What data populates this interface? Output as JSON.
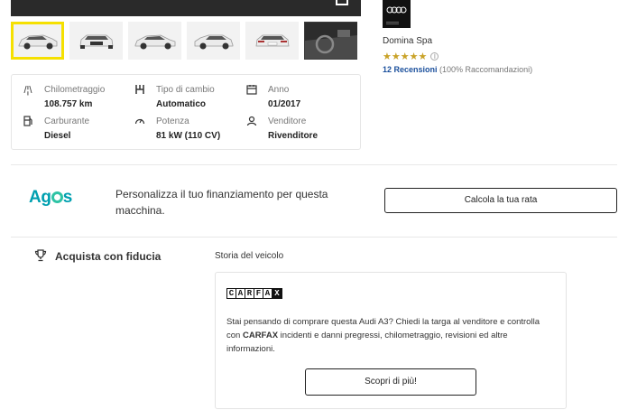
{
  "gallery": {
    "thumbnails": [
      {
        "label": "front-3q-view",
        "active": true
      },
      {
        "label": "front-view",
        "active": false
      },
      {
        "label": "side-view",
        "active": false
      },
      {
        "label": "rear-3q-view",
        "active": false
      },
      {
        "label": "rear-view",
        "active": false
      },
      {
        "label": "interior-view",
        "active": false
      }
    ]
  },
  "specs": {
    "mileage": {
      "label": "Chilometraggio",
      "value": "108.757 km",
      "icon": "road-icon"
    },
    "gearbox": {
      "label": "Tipo di cambio",
      "value": "Automatico",
      "icon": "gearshift-icon"
    },
    "year": {
      "label": "Anno",
      "value": "01/2017",
      "icon": "calendar-icon"
    },
    "fuel": {
      "label": "Carburante",
      "value": "Diesel",
      "icon": "fuel-icon"
    },
    "power": {
      "label": "Potenza",
      "value": "81 kW (110 CV)",
      "icon": "speedometer-icon"
    },
    "seller": {
      "label": "Venditore",
      "value": "Rivenditore",
      "icon": "person-icon"
    }
  },
  "dealer": {
    "name": "Domina Spa",
    "rating_stars": "★★★★★",
    "reviews_link": "12 Recensioni",
    "reviews_suffix": " (100% Raccomandazioni)"
  },
  "finance": {
    "brand": "Agos",
    "brand_left": "Ag",
    "brand_right": "s",
    "text": "Personalizza il tuo finanziamento per questa macchina.",
    "button_label": "Calcola la tua rata"
  },
  "trust": {
    "title": "Acquista con fiducia",
    "history_title": "Storia del veicolo",
    "carfax_letters": [
      "C",
      "A",
      "R",
      "F",
      "A",
      "X"
    ],
    "text_before": "Stai pensando di comprare questa Audi A3? Chiedi la targa al venditore e controlla con ",
    "text_bold": "CARFAX",
    "text_after": " incidenti e danni pregressi, chilometraggio, revisioni ed altre informazioni.",
    "button_label": "Scopri di più!"
  },
  "colors": {
    "thumb_active_border": "#f5e000",
    "agos_brand": "#00a0b0",
    "review_link": "#1a4f9c",
    "star": "#c9a227"
  }
}
